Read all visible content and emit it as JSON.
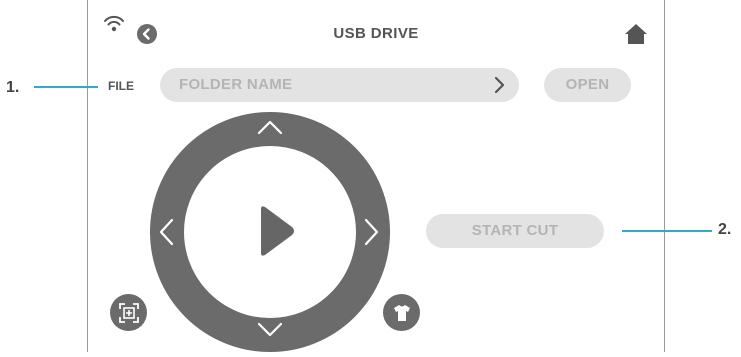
{
  "header": {
    "title": "USB DRIVE",
    "icons": [
      "wifi-icon",
      "back-icon",
      "home-icon"
    ]
  },
  "callouts": [
    {
      "label": "1."
    },
    {
      "label": "2."
    }
  ],
  "file_row": {
    "label": "FILE",
    "folder_placeholder": "FOLDER NAME",
    "open_label": "OPEN"
  },
  "controls": {
    "start_cut_label": "START CUT",
    "icons": [
      "arrow-up-icon",
      "arrow-down-icon",
      "arrow-left-icon",
      "arrow-right-icon",
      "play-icon",
      "frame-icon",
      "tshirt-icon"
    ]
  },
  "colors": {
    "accent_line": "#2eaacc",
    "dark_gray": "#6b6b6b",
    "button_bg": "#e3e3e3",
    "button_text": "#b4b4b4"
  }
}
